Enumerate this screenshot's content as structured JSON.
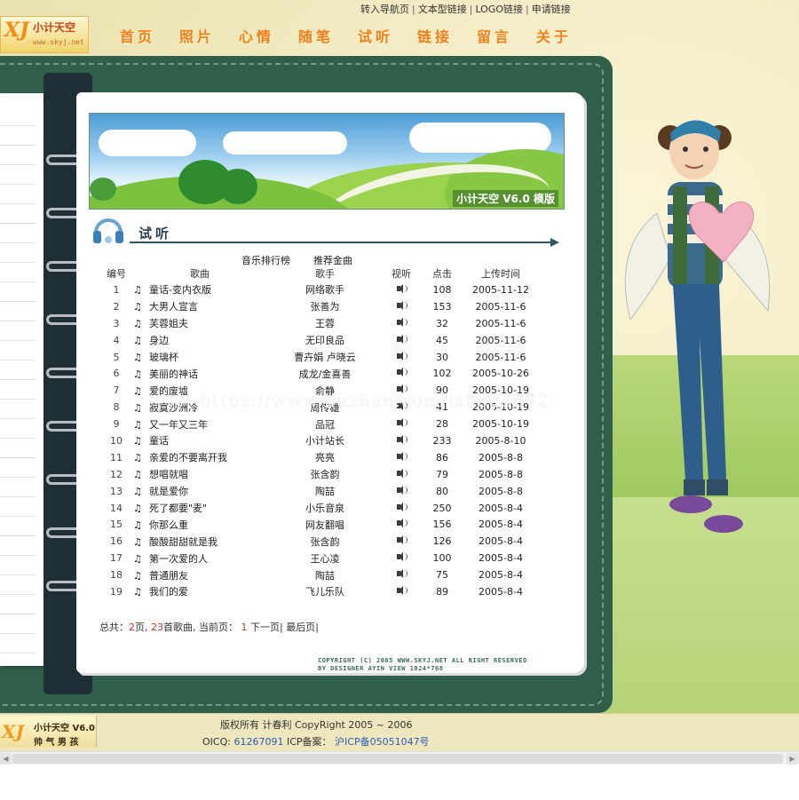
{
  "logo": {
    "name": "小计天空",
    "url_text": "www.skyj.net",
    "mark": "XJ"
  },
  "top_links": [
    "转入导航页",
    "文本型链接",
    "LOGO链接",
    "申请链接"
  ],
  "menu": [
    "首页",
    "照片",
    "心情",
    "随笔",
    "试听",
    "链接",
    "留言",
    "关于"
  ],
  "banner": {
    "title": "小计天空 V6.0 模版"
  },
  "section": {
    "title": "试听"
  },
  "subtabs": [
    "音乐排行榜",
    "推荐金曲"
  ],
  "table": {
    "headers": [
      "编号",
      "歌曲",
      "歌手",
      "视听",
      "点击",
      "上传时间"
    ],
    "rows": [
      {
        "no": "1",
        "song": "童话-变内衣版",
        "singer": "网络歌手",
        "hits": "108",
        "date": "2005-11-12"
      },
      {
        "no": "2",
        "song": "大男人宣言",
        "singer": "张善为",
        "hits": "153",
        "date": "2005-11-6"
      },
      {
        "no": "3",
        "song": "芙蓉姐夫",
        "singer": "王蓉",
        "hits": "32",
        "date": "2005-11-6"
      },
      {
        "no": "4",
        "song": "身边",
        "singer": "无印良品",
        "hits": "45",
        "date": "2005-11-6"
      },
      {
        "no": "5",
        "song": "玻璃杯",
        "singer": "曹卉娟 卢晓云",
        "hits": "30",
        "date": "2005-11-6"
      },
      {
        "no": "6",
        "song": "美丽的神话",
        "singer": "成龙/金喜善",
        "hits": "102",
        "date": "2005-10-26"
      },
      {
        "no": "7",
        "song": "爱的废墟",
        "singer": "俞静",
        "hits": "90",
        "date": "2005-10-19"
      },
      {
        "no": "8",
        "song": "寂寞沙洲冷",
        "singer": "周传雄",
        "hits": "41",
        "date": "2005-10-19"
      },
      {
        "no": "9",
        "song": "又一年又三年",
        "singer": "品冠",
        "hits": "28",
        "date": "2005-10-19"
      },
      {
        "no": "10",
        "song": "童话",
        "singer": "小计站长",
        "hits": "233",
        "date": "2005-8-10"
      },
      {
        "no": "11",
        "song": "亲爱的不要离开我",
        "singer": "亮亮",
        "hits": "86",
        "date": "2005-8-8"
      },
      {
        "no": "12",
        "song": "想唱就唱",
        "singer": "张含韵",
        "hits": "79",
        "date": "2005-8-8"
      },
      {
        "no": "13",
        "song": "就是爱你",
        "singer": "陶喆",
        "hits": "80",
        "date": "2005-8-8"
      },
      {
        "no": "14",
        "song": "死了都要\"麦\"",
        "singer": "小乐音泉",
        "hits": "250",
        "date": "2005-8-4"
      },
      {
        "no": "15",
        "song": "你那么重",
        "singer": "网友翻唱",
        "hits": "156",
        "date": "2005-8-4"
      },
      {
        "no": "16",
        "song": "酸酸甜甜就是我",
        "singer": "张含韵",
        "hits": "126",
        "date": "2005-8-4"
      },
      {
        "no": "17",
        "song": "第一次爱的人",
        "singer": "王心凌",
        "hits": "100",
        "date": "2005-8-4"
      },
      {
        "no": "18",
        "song": "普通朋友",
        "singer": "陶喆",
        "hits": "75",
        "date": "2005-8-4"
      },
      {
        "no": "19",
        "song": "我们的爱",
        "singer": "飞儿乐队",
        "hits": "89",
        "date": "2005-8-4"
      }
    ]
  },
  "pager": {
    "prefix": "总共：",
    "pages": "2",
    "mid1": "页, ",
    "songs": "23",
    "mid2": "首歌曲, 当前页：",
    "current": "1",
    "next": "下一页",
    "last": "最后页"
  },
  "page_copyright": [
    "COPYRIGHT (C) 2005 WWW.SKYJ.NET ALL RIGHT RESERVED",
    "BY DESIGNER AYIN VIEW 1024*768"
  ],
  "watermark": "https://www.huzhan.com/ishop3572",
  "footer": {
    "logo_line1": "小计天空 V6.0",
    "logo_line2": "帅 气 男 孩",
    "copyright": "版权所有 计春利 CopyRight 2005 ~ 2006",
    "oicq_label": "OICQ:",
    "oicq": "61267091",
    "icp_label": "ICP备案：",
    "icp": "沪ICP备05051047号"
  },
  "colors": {
    "menu": "#f0801c",
    "binder": "#2f5e4a",
    "accent_red": "#c0392b",
    "link_blue": "#2a5db0"
  }
}
